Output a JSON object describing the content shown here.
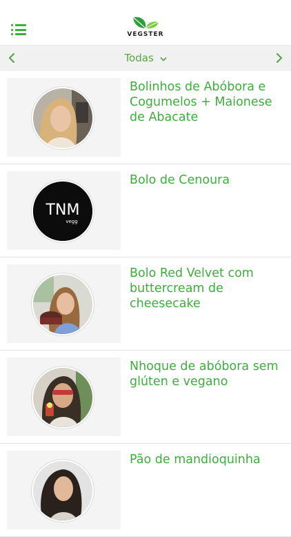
{
  "app": {
    "brand": "VEGSTER"
  },
  "header": {
    "menu_icon": "list-menu-icon",
    "logo_icon": "leaf-logo-icon"
  },
  "filter": {
    "selected": "Todas",
    "prev_icon": "chevron-left-icon",
    "next_icon": "chevron-right-icon",
    "dropdown_icon": "chevron-down-icon"
  },
  "colors": {
    "accent": "#3cae3c",
    "filter_text": "#5aa646",
    "filter_bg": "#f1f1f1",
    "thumb_bg": "#f4f4f4"
  },
  "recipes": [
    {
      "title": "Bolinhos de Abóbora e Cogumelos + Maionese de Abacate"
    },
    {
      "title": "Bolo de Cenoura",
      "avatar_text": "TNM",
      "avatar_subtext": "vegg"
    },
    {
      "title": "Bolo Red Velvet com buttercream de cheesecake"
    },
    {
      "title": "Nhoque de abóbora sem glúten e vegano"
    },
    {
      "title": "Pão de mandioquinha"
    }
  ]
}
